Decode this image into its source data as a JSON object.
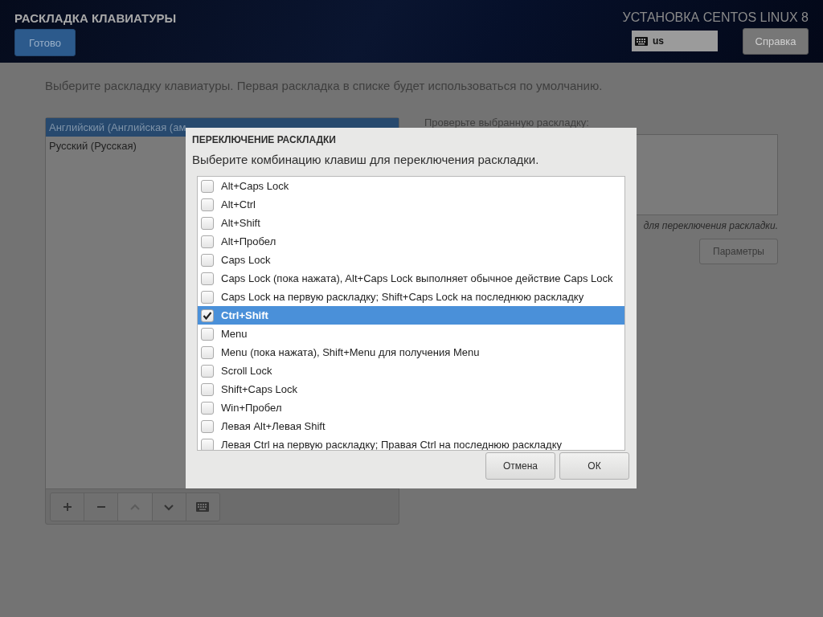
{
  "header": {
    "title": "РАСКЛАДКА КЛАВИАТУРЫ",
    "done_button": "Готово",
    "installer_title": "УСТАНОВКА CENTOS LINUX 8",
    "keyboard_indicator": {
      "layout": "us"
    },
    "help_button": "Справка"
  },
  "instruction": "Выберите раскладку клавиатуры. Первая раскладка в списке будет использоваться по умолчанию.",
  "layouts": [
    {
      "label": "Английский (Английская (ам",
      "selected": true
    },
    {
      "label": "Русский (Русская)",
      "selected": false
    }
  ],
  "toolbar": [
    {
      "kind": "add",
      "disabled": false
    },
    {
      "kind": "remove",
      "disabled": false
    },
    {
      "kind": "up",
      "disabled": true
    },
    {
      "kind": "down",
      "disabled": false
    },
    {
      "kind": "keyboard",
      "disabled": false
    }
  ],
  "test_area": {
    "label": "Проверьте выбранную раскладку:",
    "hint": "для переключения раскладки.",
    "options_button": "Параметры"
  },
  "dialog": {
    "title": "ПЕРЕКЛЮЧЕНИЕ РАСКЛАДКИ",
    "prompt": "Выберите комбинацию клавиш для переключения раскладки.",
    "options": [
      {
        "label": "Alt+Caps Lock",
        "checked": false,
        "selected": false
      },
      {
        "label": "Alt+Ctrl",
        "checked": false,
        "selected": false
      },
      {
        "label": "Alt+Shift",
        "checked": false,
        "selected": false
      },
      {
        "label": "Alt+Пробел",
        "checked": false,
        "selected": false
      },
      {
        "label": "Caps Lock",
        "checked": false,
        "selected": false
      },
      {
        "label": "Caps Lock (пока нажата), Alt+Caps Lock выполняет обычное действие Caps Lock",
        "checked": false,
        "selected": false
      },
      {
        "label": "Caps Lock на первую раскладку; Shift+Caps Lock на последнюю раскладку",
        "checked": false,
        "selected": false
      },
      {
        "label": "Ctrl+Shift",
        "checked": true,
        "selected": true
      },
      {
        "label": "Menu",
        "checked": false,
        "selected": false
      },
      {
        "label": "Menu (пока нажата), Shift+Menu для получения Menu",
        "checked": false,
        "selected": false
      },
      {
        "label": "Scroll Lock",
        "checked": false,
        "selected": false
      },
      {
        "label": "Shift+Caps Lock",
        "checked": false,
        "selected": false
      },
      {
        "label": "Win+Пробел",
        "checked": false,
        "selected": false
      },
      {
        "label": "Левая Alt+Левая Shift",
        "checked": false,
        "selected": false
      },
      {
        "label": "Левая Ctrl на первую раскладку; Правая Ctrl на последнюю раскладку",
        "checked": false,
        "selected": false
      }
    ],
    "cancel_button": "Отмена",
    "ok_button": "ОК"
  }
}
